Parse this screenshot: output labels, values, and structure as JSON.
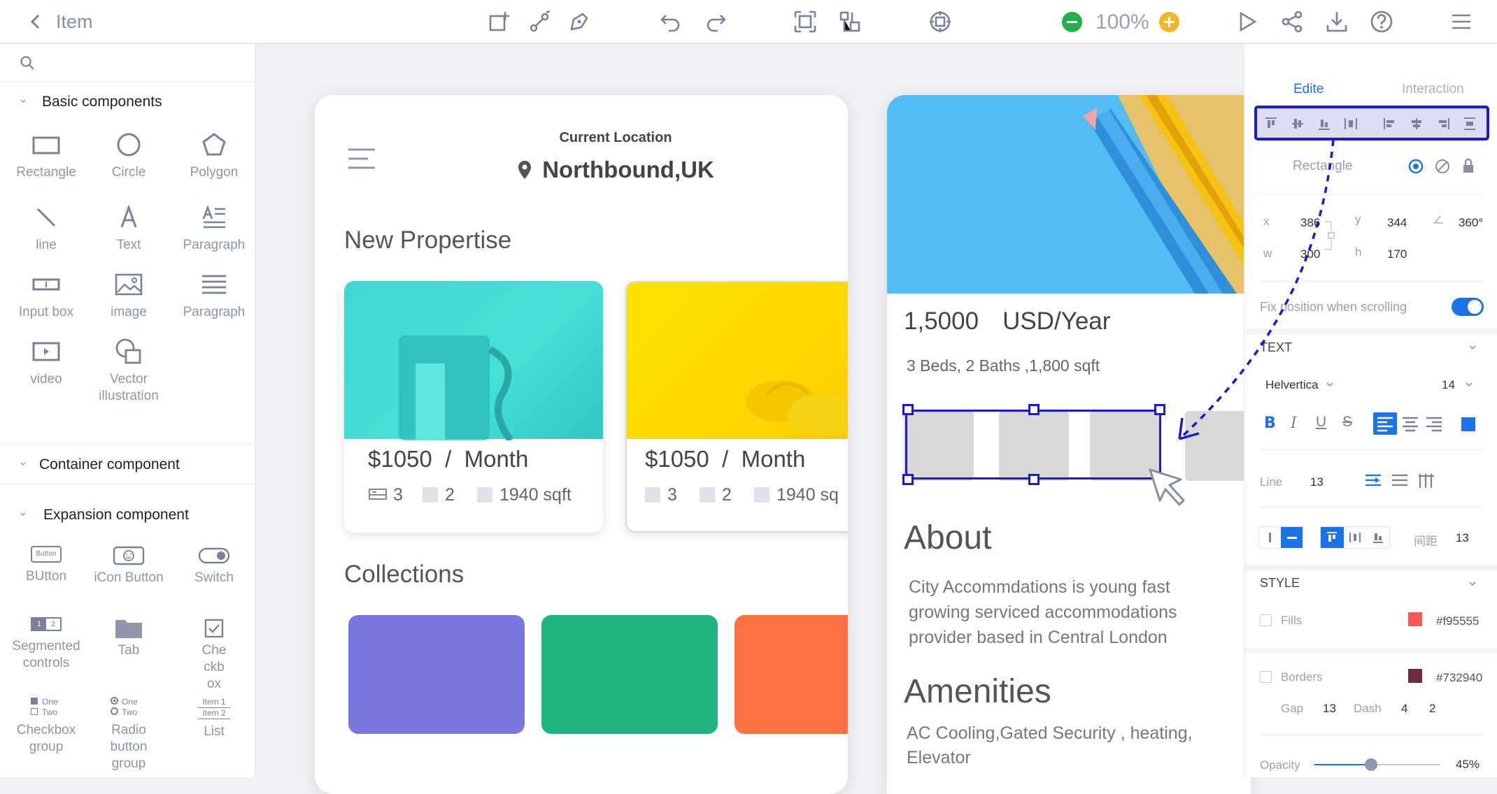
{
  "topbar": {
    "back_label": "Item",
    "zoom": "100%",
    "icons": [
      "back-icon",
      "new-page-icon",
      "vector-icon",
      "pen-icon",
      "undo-icon",
      "redo-icon",
      "frame-icon",
      "align-icon",
      "target-icon",
      "zoom-out-icon",
      "zoom-in-icon",
      "play-icon",
      "share-icon",
      "download-icon",
      "help-icon",
      "menu-icon"
    ]
  },
  "left": {
    "search_placeholder": "",
    "basic_title": "Basic components",
    "basic": [
      {
        "label": "Rectangle",
        "icon": "rectangle-icon"
      },
      {
        "label": "Circle",
        "icon": "circle-icon"
      },
      {
        "label": "Polygon",
        "icon": "polygon-icon"
      },
      {
        "label": "line",
        "icon": "line-icon"
      },
      {
        "label": "Text",
        "icon": "text-icon"
      },
      {
        "label": "Paragraph",
        "icon": "paragraph-icon"
      },
      {
        "label": "Input box",
        "icon": "input-box-icon"
      },
      {
        "label": "image",
        "icon": "image-icon"
      },
      {
        "label": "Paragraph",
        "icon": "paragraph-lines-icon"
      },
      {
        "label": "video",
        "icon": "video-icon"
      },
      {
        "label": "Vector illustration",
        "icon": "vector-illustration-icon"
      }
    ],
    "container_title": "Container component",
    "expansion_title": "Expansion component",
    "expansion": [
      {
        "label": "BUtton",
        "icon": "button-icon",
        "inner": "Button"
      },
      {
        "label": "iCon Button",
        "icon": "icon-button-icon"
      },
      {
        "label": "Switch",
        "icon": "switch-icon"
      },
      {
        "label": "Segmented controls",
        "icon": "segmented-icon",
        "inner": [
          "1",
          "2"
        ]
      },
      {
        "label": "Tab",
        "icon": "tab-icon"
      },
      {
        "label": "Checkbox",
        "icon": "checkbox-icon"
      },
      {
        "label": "Checkbox group",
        "icon": "checkbox-group-icon",
        "inner": [
          "One",
          "Two"
        ]
      },
      {
        "label": "Radio button group",
        "icon": "radio-group-icon",
        "inner": [
          "One",
          "Two"
        ]
      },
      {
        "label": "List",
        "icon": "list-icon",
        "inner": [
          "Item 1",
          "Item 2"
        ]
      }
    ]
  },
  "phone1": {
    "location_caption": "Current Location",
    "location": "Northbound,UK",
    "new_title": "New Propertise",
    "cards": [
      {
        "price": "$1050  /  Month",
        "beds": "3",
        "baths": "2",
        "area": "1940 sqft"
      },
      {
        "price": "$1050  /  Month",
        "beds": "3",
        "baths": "2",
        "area": "1940 sq"
      }
    ],
    "collections_title": "Collections",
    "collection_colors": [
      "#7b77e0",
      "#1db57d",
      "#ff7043"
    ]
  },
  "phone2": {
    "price": "1,5000",
    "price_unit": "USD/Year",
    "details": "3 Beds, 2 Baths ,1,800 sqft",
    "about_title": "About",
    "about_text": "City Accommdations  is young fast growing serviced accommodations provider based in Central London",
    "amenities_title": "Amenities",
    "amenities_text": "AC Cooling,Gated Security , heating, Elevator"
  },
  "right": {
    "tab_edit": "Edite",
    "tab_interaction": "Interaction",
    "shape_name": "Rectangle",
    "x_label": "x",
    "x_value": "386",
    "y_label": "y",
    "y_value": "344",
    "angle_value": "360°",
    "w_label": "w",
    "w_value": "300",
    "h_label": "h",
    "h_value": "170",
    "fix_label": "Fix position when scrolling",
    "fix_on": true,
    "text_title": "TEXT",
    "font": "Helvertica",
    "font_size": "14",
    "line_label": "Line",
    "line_value": "13",
    "spacing_label": "间距",
    "spacing_value": "13",
    "style_title": "STYLE",
    "fills_label": "Fills",
    "fills_hex": "#f95555",
    "fills_color": "#f95555",
    "borders_label": "Borders",
    "borders_hex": "#732940",
    "borders_color": "#732940",
    "gap_label": "Gap",
    "gap_value": "13",
    "dash_label": "Dash",
    "dash_value_1": "4",
    "dash_value_2": "2",
    "opacity_label": "Opacity",
    "opacity_value": "45%",
    "opacity_fraction": 0.45,
    "accent": "#1a73e8",
    "selection": "#1a1ad4"
  }
}
